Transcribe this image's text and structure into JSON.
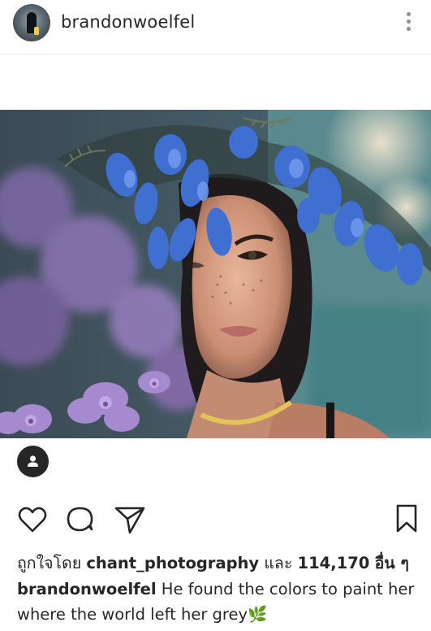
{
  "post": {
    "username": "brandonwoelfel",
    "likes": {
      "prefix": "ถูกใจโดย",
      "liker": "chant_photography",
      "connector": "และ",
      "count": "114,170",
      "suffix": "อื่น ๆ"
    },
    "caption": {
      "username": "brandonwoelfel",
      "text": "He found the colors to paint her where the world left her grey",
      "emoji": "🌿"
    }
  },
  "icons": {
    "more": "more-vertical-icon",
    "tag": "person-tag-icon",
    "like": "heart-icon",
    "comment": "comment-icon",
    "share": "direct-share-icon",
    "save": "bookmark-icon"
  },
  "colors": {
    "text": "#262626",
    "muted": "#8e8e8e"
  }
}
